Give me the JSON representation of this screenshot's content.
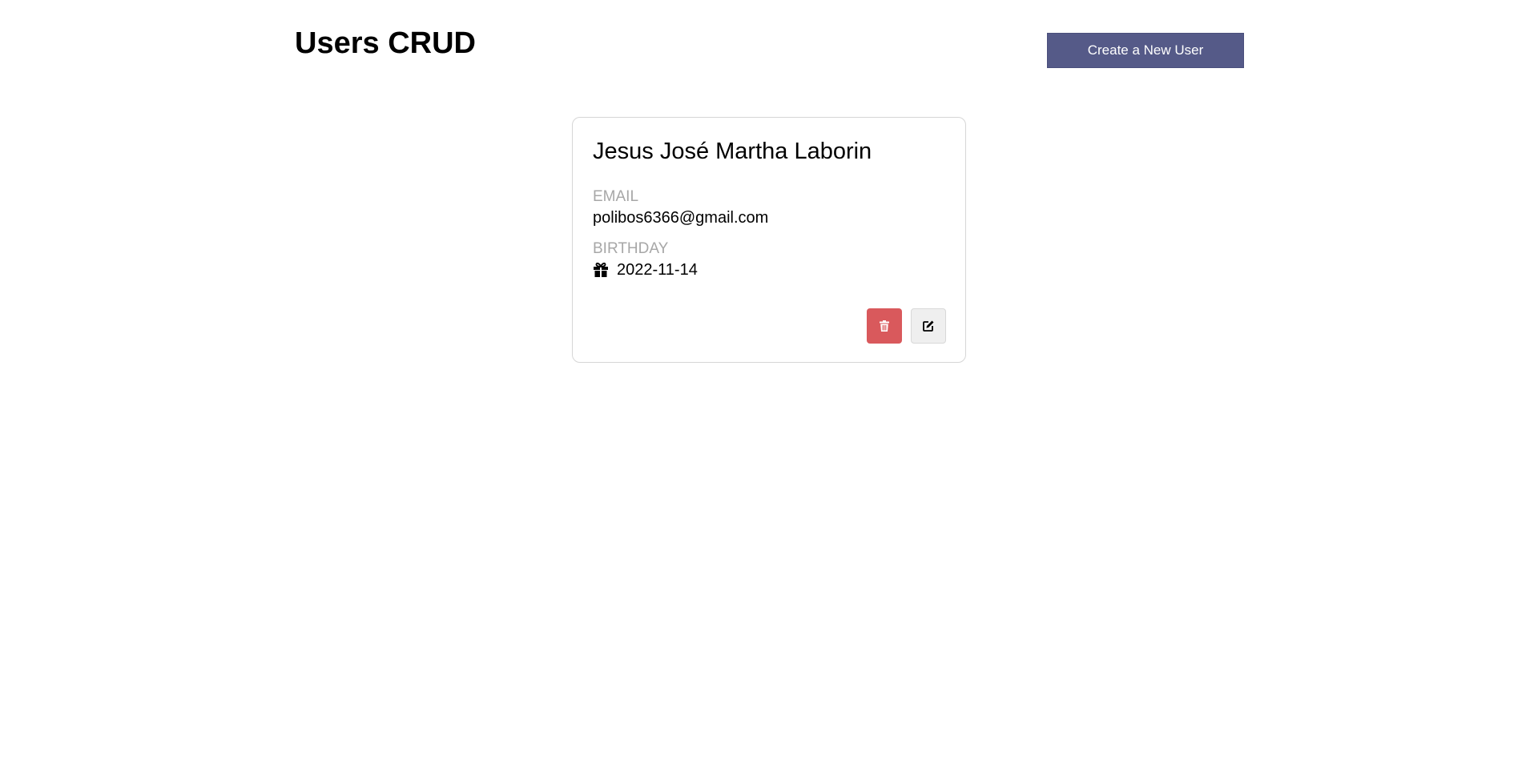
{
  "header": {
    "title": "Users CRUD",
    "create_button_label": "Create a New User"
  },
  "users": [
    {
      "name": "Jesus José Martha Laborin",
      "email_label": "EMAIL",
      "email": "polibos6366@gmail.com",
      "birthday_label": "BIRTHDAY",
      "birthday": "2022-11-14",
      "birthday_icon": "gift-icon",
      "actions": [
        {
          "name": "delete",
          "icon": "trash-icon",
          "color": "#d9595c"
        },
        {
          "name": "edit",
          "icon": "edit-icon",
          "color": "#efefef"
        }
      ]
    }
  ],
  "colors": {
    "accent": "#555a88",
    "danger": "#d9595c",
    "label_gray": "#a7a7a7",
    "card_border": "#d6d6d6"
  }
}
